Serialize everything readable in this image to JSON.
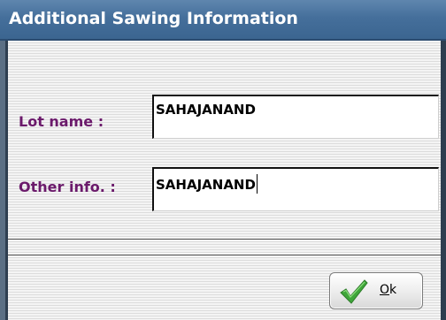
{
  "window": {
    "title": "Additional Sawing Information"
  },
  "form": {
    "lot_name": {
      "label": "Lot name :",
      "value": "SAHAJANAND"
    },
    "other_info": {
      "label": "Other info. :",
      "value": "SAHAJANAND"
    }
  },
  "buttons": {
    "ok": {
      "accel": "O",
      "rest": "k",
      "icon": "checkmark-icon"
    }
  },
  "colors": {
    "title_bar": "#456f9b",
    "label_text": "#6b1a6b",
    "checkmark": "#3fa63a"
  }
}
